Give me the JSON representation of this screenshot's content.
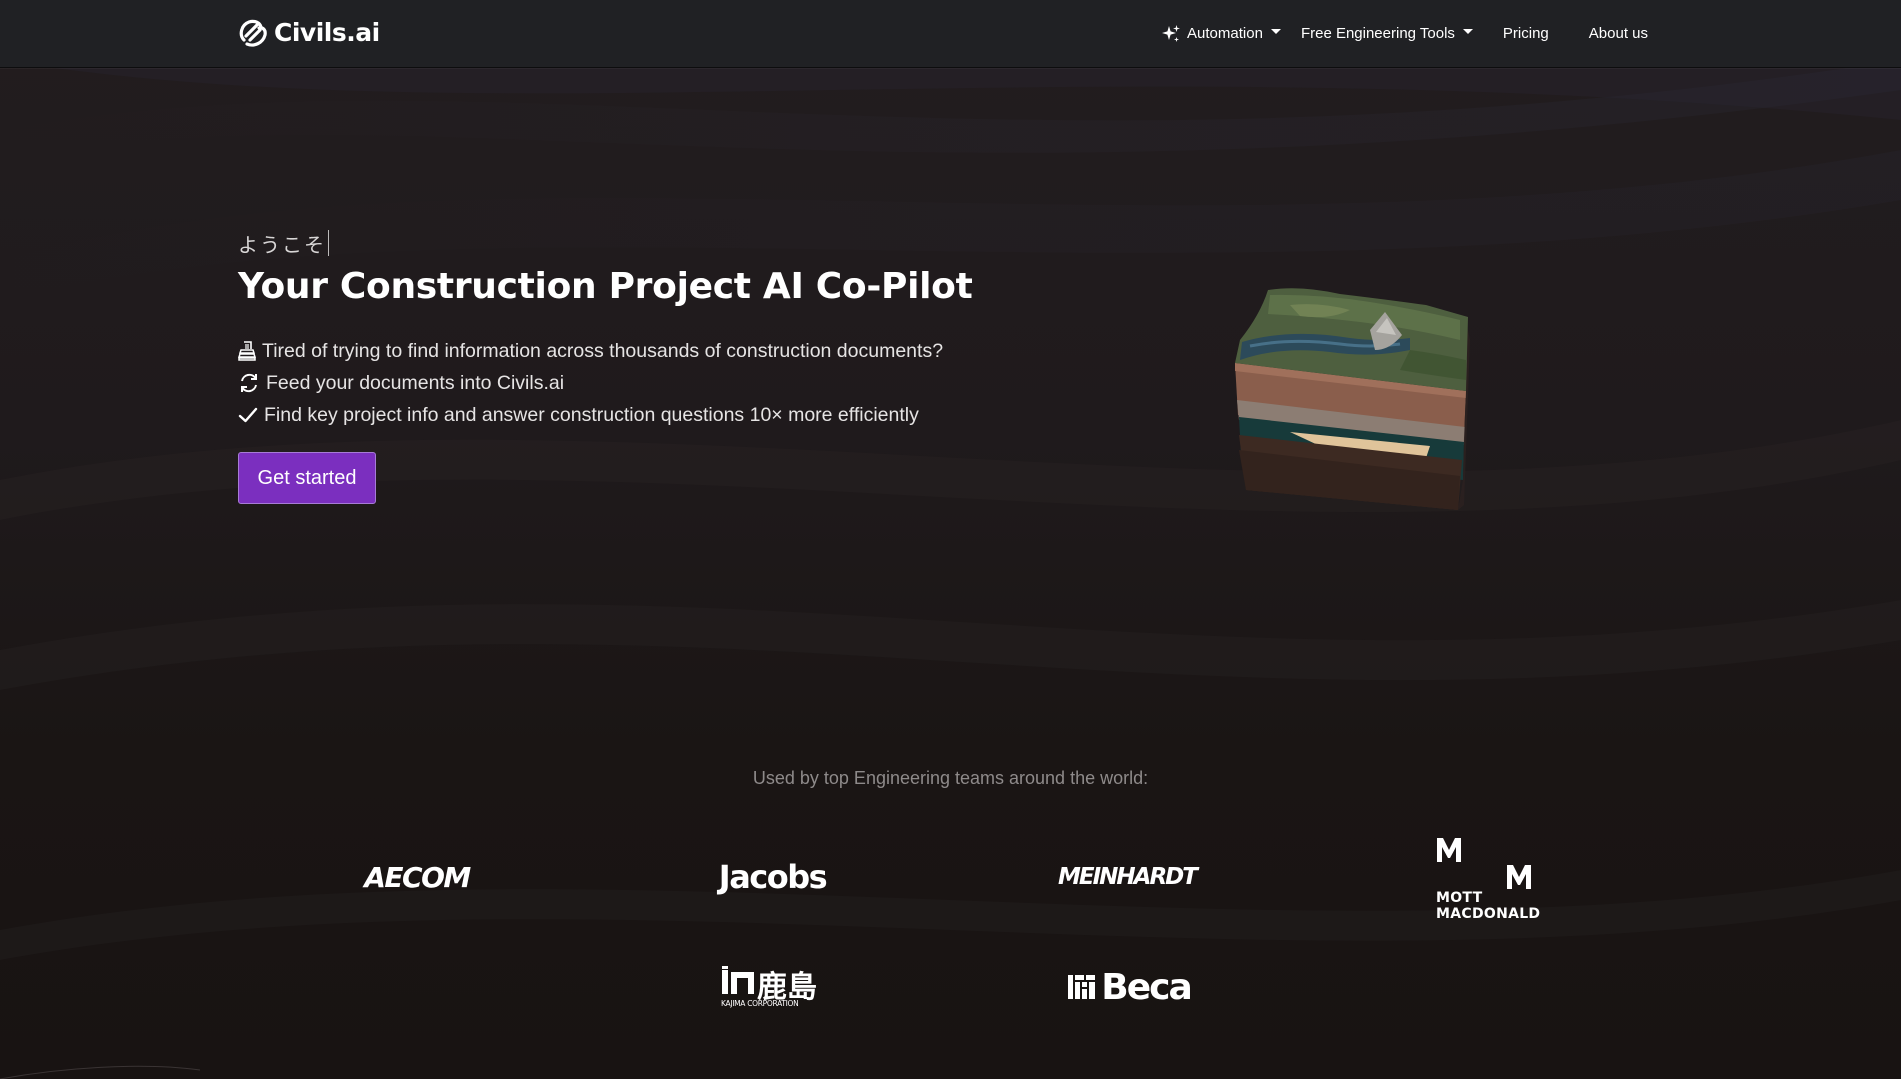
{
  "nav": {
    "brand": "Civils.ai",
    "items": [
      {
        "label": "Automation",
        "icon": "sparkles-icon",
        "dropdown": true
      },
      {
        "label": "Free Engineering Tools",
        "dropdown": true
      },
      {
        "label": "Pricing",
        "dropdown": false
      },
      {
        "label": "About us",
        "dropdown": false
      }
    ]
  },
  "hero": {
    "welcome": "ようこそ",
    "title": "Your Construction Project AI Co-Pilot",
    "features": [
      {
        "icon": "document-stack-icon",
        "text": "Tired of trying to find information across thousands of construction documents?"
      },
      {
        "icon": "sync-icon",
        "text": "Feed your documents into Civils.ai"
      },
      {
        "icon": "check-icon",
        "text": "Find key project info and answer construction questions 10× more efficiently"
      }
    ],
    "cta": "Get started"
  },
  "clients": {
    "caption": "Used by top Engineering teams around the world:",
    "logos": {
      "aecom": "AECOM",
      "jacobs": "Jacobs",
      "meinhardt": "MEINHARDT",
      "mott_line1": "MOTT",
      "mott_line2": "MACDONALD",
      "kajima_jp": "鹿島",
      "kajima_sub": "KAJIMA CORPORATION",
      "beca": "Beca"
    }
  },
  "colors": {
    "nav_bg": "#202124",
    "accent": "#7b2fbf",
    "page_bg": "#1a1514"
  }
}
